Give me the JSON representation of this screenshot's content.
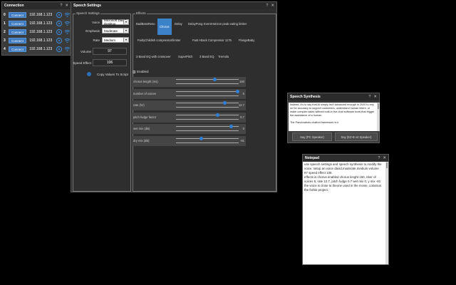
{
  "connection": {
    "title": "Connection",
    "rows": [
      {
        "idx": "0",
        "button": "Connect",
        "ip": "192.168.1.123"
      },
      {
        "idx": "1",
        "button": "Connect",
        "ip": "192.168.1.123"
      },
      {
        "idx": "2",
        "button": "Connect",
        "ip": "192.168.1.123"
      },
      {
        "idx": "3",
        "button": "Connect",
        "ip": "192.168.1.123"
      },
      {
        "idx": "4",
        "button": "Connect",
        "ip": "192.168.1.123"
      }
    ]
  },
  "speech_settings": {
    "title": "Speech Settings",
    "group_label": "Speech Settings",
    "voice_label": "Voice",
    "voice_value": "Microsoft David Desktop",
    "emphasis_label": "Emphasis",
    "emphasis_value": "Moderate",
    "rate_label": "Rate",
    "rate_value": "Medium",
    "volume_label": "Volume",
    "volume_value": "97",
    "speed_label": "Speed Effect",
    "speed_value": "106",
    "copy_label": "Copy Values To Script",
    "effects_label": "Effects",
    "effects": [
      "BadBassReso",
      "Chorus",
      "Delay",
      "DelayPong",
      "EventHorizon peak eating limiter",
      "FairlyChildish compressor/limiter",
      "Fast Attack Compressor 1175",
      "FlangeBaby",
      "3 Band EQ with crossover",
      "SuperPitch",
      "3 Band EQ",
      "Tremolo"
    ],
    "selected_effect": "Chorus",
    "enabled_label": "Enabled",
    "params": [
      {
        "label": "chorus length (ms)",
        "value": "160",
        "pos": 0.62
      },
      {
        "label": "number of voices",
        "value": "5",
        "pos": 0.98
      },
      {
        "label": "rate (hz)",
        "value": "12.7",
        "pos": 0.78
      },
      {
        "label": "pitch fudge factor",
        "value": "0.7",
        "pos": 0.66
      },
      {
        "label": "wet mix (dB)",
        "value": "0",
        "pos": 0.88
      },
      {
        "label": "dry mix (dB)",
        "value": "-81",
        "pos": 0.4
      }
    ]
  },
  "speech_synthesis": {
    "title": "Speech Synthesis",
    "text": "Instead, it's to say that AI simply isn't advanced enough in 2020 to rely on for accuracy to support customers, understand human intent, or make complex sales without built-in live chat software tools that trigger the assistance of a human.\n\nThe Pandorabots chatbot framework is b",
    "say_pc": "Say (PC Speaker)",
    "say_ez": "Say (EZ-B v4 Speaker)"
  },
  "notepad": {
    "title": "Notepad",
    "text": "use speech settings and speech synthesis to modify the voice. setup an voice david,moderate,medium volume 97 speed effect 106\neffects is chorus enabled chorus lenght 160, nber of voices 5, rate 12.7, pitch fudge 0.7 wet mix 0, y mix -81\nthe voice is close to theone used in the movie, colossus the forbin project."
  }
}
